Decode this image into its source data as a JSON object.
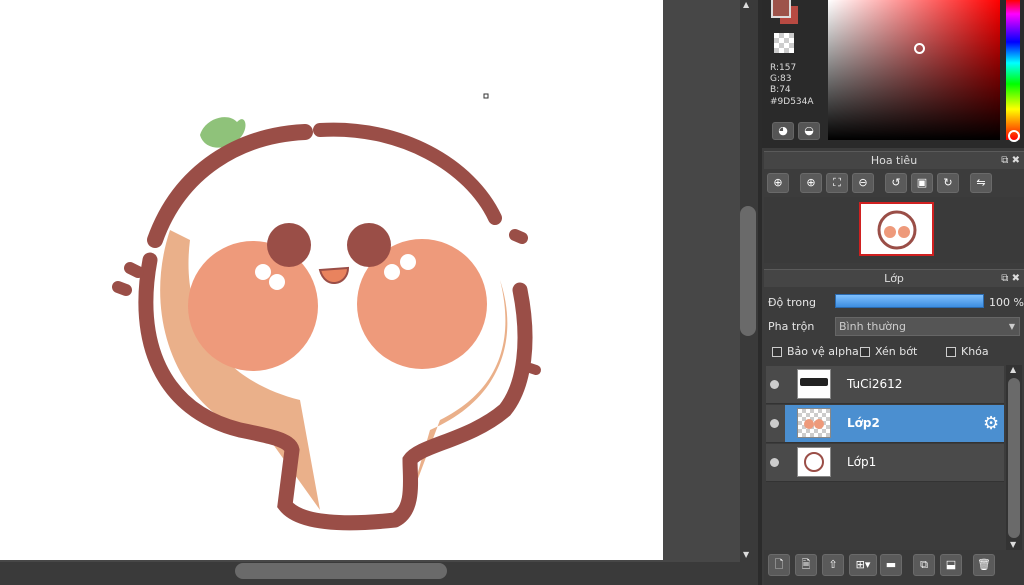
{
  "color": {
    "primary_hex": "#9D534A",
    "r_text": "R:157",
    "g_text": "G:83",
    "b_text": "B:74",
    "hex_text": "#9D534A"
  },
  "navigator": {
    "title": "Hoa tiêu"
  },
  "layers_panel": {
    "title": "Lớp",
    "opacity_label": "Độ trong",
    "opacity_value": "100 %",
    "opacity_fraction": 1.0,
    "blend_label": "Pha trộn",
    "blend_value": "Bình thường",
    "protect_alpha_label": "Bảo vệ alpha",
    "clipping_label": "Xén bớt",
    "lock_label": "Khóa",
    "layers": [
      {
        "name": "TuCi2612",
        "selected": false
      },
      {
        "name": "Lớp2",
        "selected": true
      },
      {
        "name": "Lớp1",
        "selected": false
      }
    ]
  },
  "icons": {
    "accent": "#4b8fd0"
  }
}
